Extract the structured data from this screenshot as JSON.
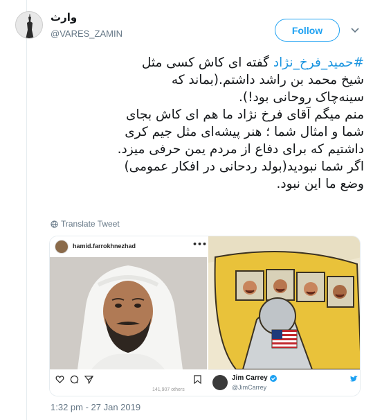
{
  "author": {
    "display_name": "وارث",
    "handle": "@VARES_ZAMIN"
  },
  "follow_label": "Follow",
  "tweet": {
    "hashtag": "#حمید_فرخ_نژاد",
    "line1_rest": " گفته ای کاش کسی مثل",
    "lines": [
      "شیخ محمد بن راشد داشتم.(بماند که",
      "سینه‌چاک روحانی بود!).",
      "منم میگم آقای فرخ نژاد ما هم ای کاش بجای",
      "شما و امثال شما ؛ هنر پیشه‌ای مثل جیم کری",
      "داشتیم که برای دفاع از مردم یمن حرفی میزد.",
      "اگر شما نبودید(بولد ردحانی در افکار عمومی)",
      "وضع ما این نبود."
    ]
  },
  "translate_label": "Translate Tweet",
  "media": {
    "instagram_username": "hamid.farrokhnezhad",
    "instagram_likes": "141,907 others",
    "embedded_tweet_name": "Jim Carrey",
    "embedded_tweet_handle": "@JimCarrey"
  },
  "timestamp": "1:32 pm - 27 Jan 2019",
  "colors": {
    "accent": "#1da1f2",
    "hashtag": "#1b95e0",
    "secondary_text": "#657786"
  }
}
